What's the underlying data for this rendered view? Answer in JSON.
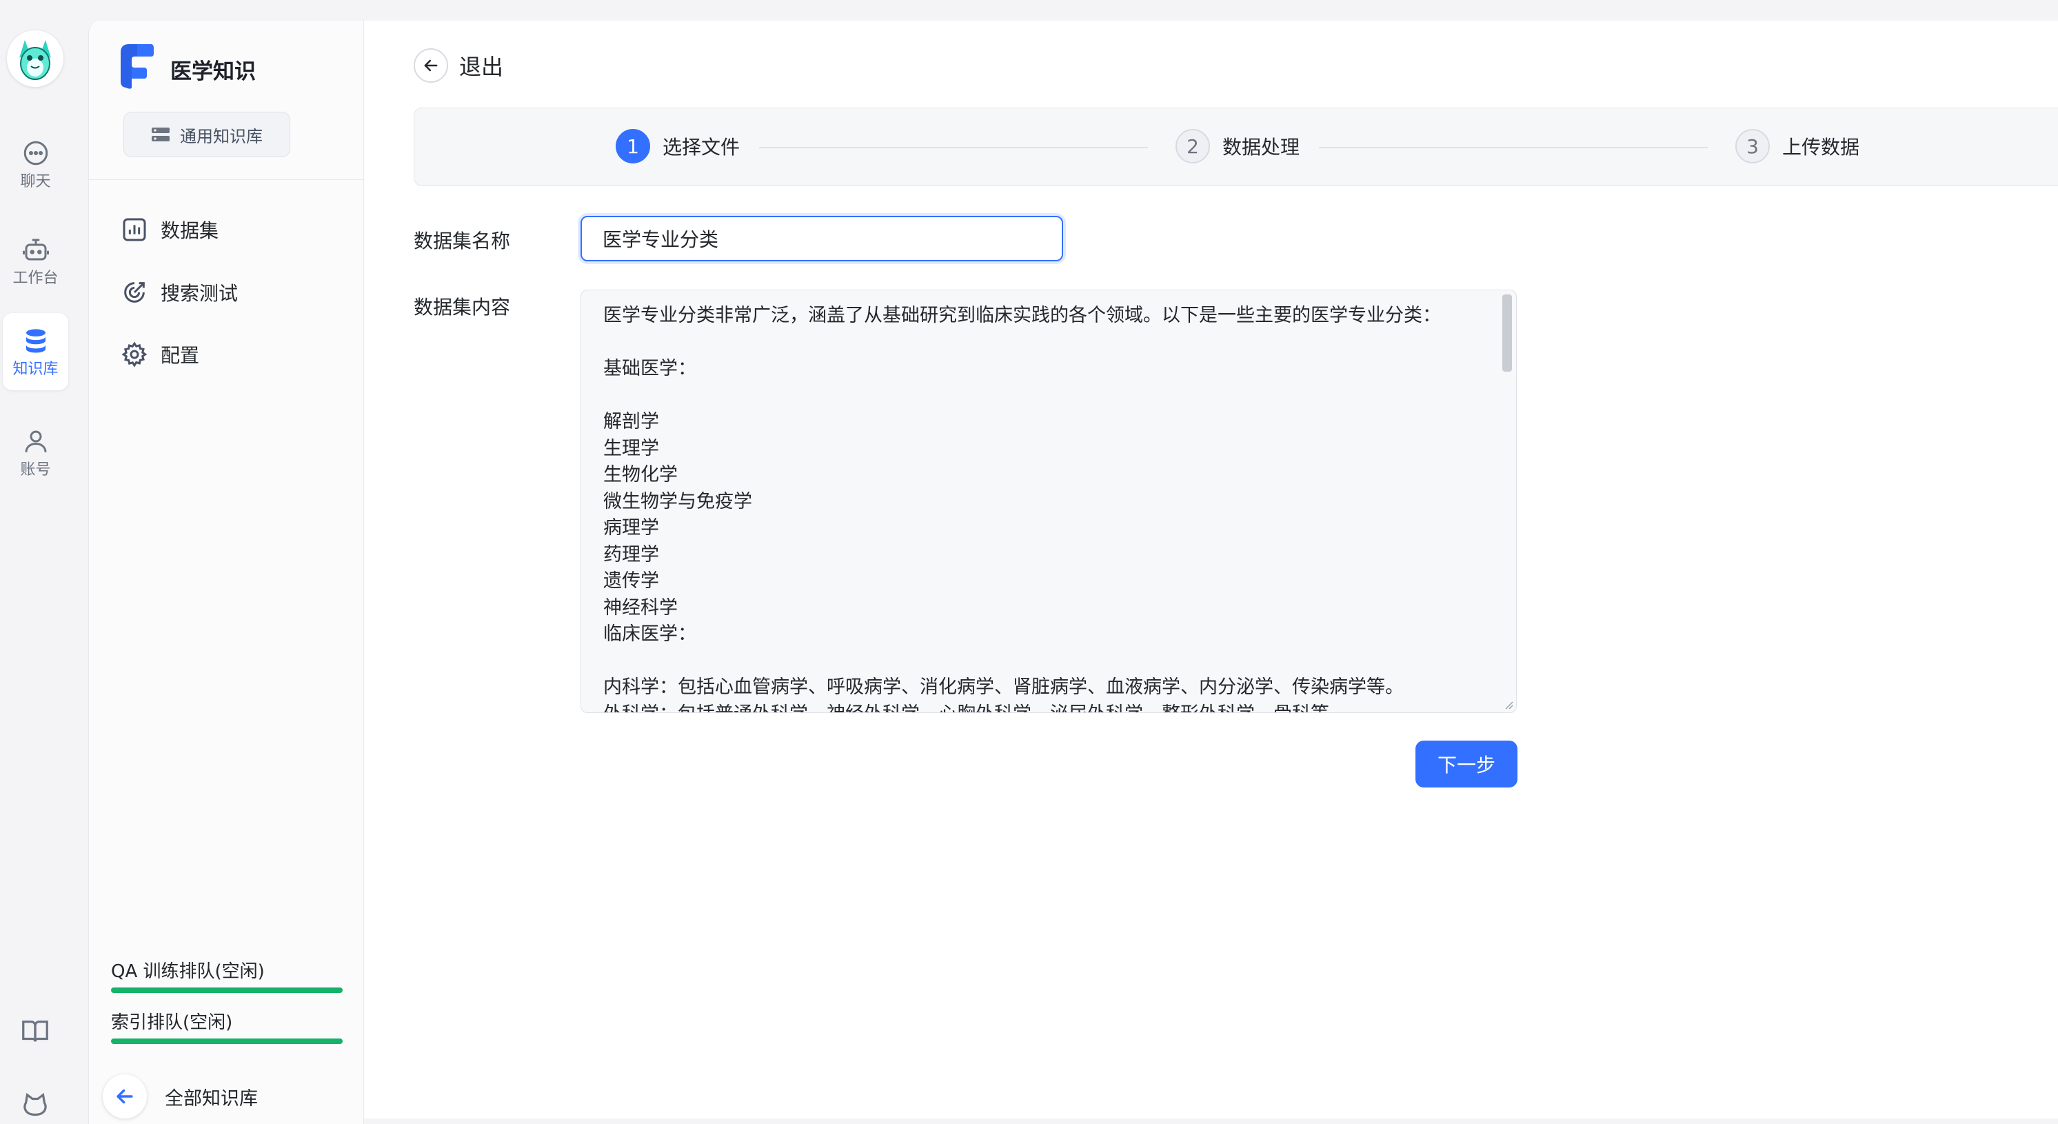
{
  "rail": {
    "items": [
      {
        "label": "聊天",
        "icon": "chat-bubble-icon"
      },
      {
        "label": "工作台",
        "icon": "robot-icon"
      },
      {
        "label": "知识库",
        "icon": "database-icon",
        "active": true
      },
      {
        "label": "账号",
        "icon": "user-icon"
      }
    ],
    "bottom_icons": [
      "book-icon",
      "github-icon"
    ]
  },
  "sidebar": {
    "kb_title": "医学知识",
    "kb_type": "通用知识库",
    "nav": [
      {
        "label": "数据集",
        "icon": "chart-icon"
      },
      {
        "label": "搜索测试",
        "icon": "target-icon"
      },
      {
        "label": "配置",
        "icon": "gear-icon"
      }
    ],
    "queues": [
      {
        "label": "QA 训练排队(空闲)",
        "progress": 1.0
      },
      {
        "label": "索引排队(空闲)",
        "progress": 1.0
      }
    ],
    "back_all": "全部知识库"
  },
  "main": {
    "exit": "退出",
    "steps": [
      {
        "num": "1",
        "label": "选择文件",
        "active": true
      },
      {
        "num": "2",
        "label": "数据处理",
        "active": false
      },
      {
        "num": "3",
        "label": "上传数据",
        "active": false
      }
    ],
    "name_label": "数据集名称",
    "name_value": "医学专业分类",
    "content_label": "数据集内容",
    "content_value": "医学专业分类非常广泛，涵盖了从基础研究到临床实践的各个领域。以下是一些主要的医学专业分类：\n\n基础医学：\n\n解剖学\n生理学\n生物化学\n微生物学与免疫学\n病理学\n药理学\n遗传学\n神经科学\n临床医学：\n\n内科学：包括心血管病学、呼吸病学、消化病学、肾脏病学、血液病学、内分泌学、传染病学等。\n外科学：包括普通外科学、神经外科学、心胸外科学、泌尿外科学、整形外科学、骨科等。",
    "next_button": "下一步"
  },
  "colors": {
    "accent": "#3370ff",
    "progress_green": "#17b26a"
  }
}
